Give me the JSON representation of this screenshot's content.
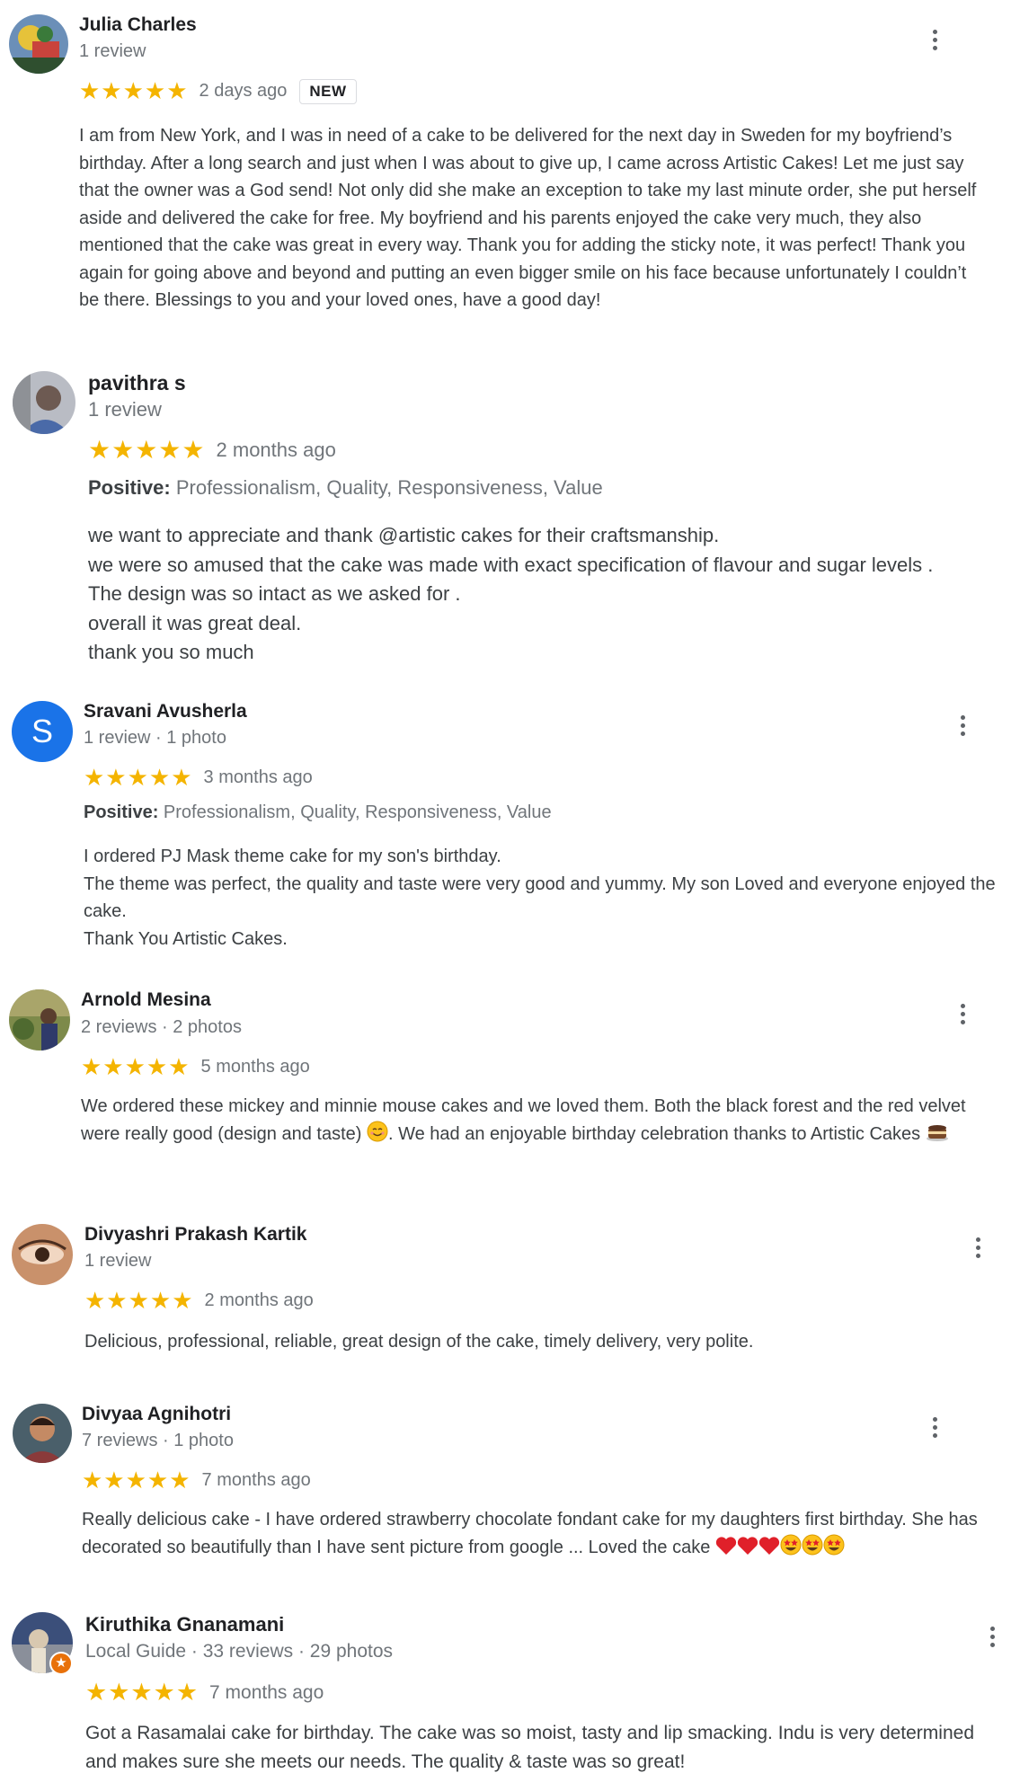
{
  "reviews": [
    {
      "name": "Julia Charles",
      "meta": "1 review",
      "stars": "★★★★★",
      "time": "2 days ago",
      "badge": "NEW",
      "text": "I am from New York, and I was in need of a cake to be delivered for the next day in Sweden for my boyfriend’s birthday. After a long search and just when I was about to give up, I came across Artistic Cakes! Let me just say that the owner was a God send! Not only did she make an exception to take my last minute order, she put herself aside and delivered the cake for free. My boyfriend and his parents enjoyed the cake very much, they also mentioned that the cake was great in every way. Thank you for adding the sticky note, it was perfect! Thank you again for going above and beyond and putting an even bigger smile on his face because unfortunately I couldn’t be there. Blessings to you and your loved ones, have a good day!"
    },
    {
      "name": "pavithra s",
      "meta": "1 review",
      "stars": "★★★★★",
      "time": "2 months ago",
      "positive_label": "Positive:",
      "positive_values": "Professionalism, Quality, Responsiveness, Value",
      "lines": [
        "we want to appreciate and thank @artistic cakes for their craftsmanship.",
        "we were so amused that the cake was made with exact specification of flavour and sugar levels .",
        "The design was so intact as we asked for .",
        "overall it was great deal.",
        "thank you so much"
      ]
    },
    {
      "name": "Sravani Avusherla",
      "avatar_letter": "S",
      "meta": "1 review · 1 photo",
      "stars": "★★★★★",
      "time": "3 months ago",
      "positive_label": "Positive:",
      "positive_values": "Professionalism, Quality, Responsiveness, Value",
      "lines": [
        "I ordered PJ Mask theme cake for my son's birthday.",
        "The theme was perfect, the quality and taste were very good and yummy. My son Loved and everyone enjoyed the cake.",
        "Thank You Artistic Cakes."
      ]
    },
    {
      "name": "Arnold Mesina",
      "meta": "2 reviews · 2 photos",
      "stars": "★★★★★",
      "time": "5 months ago",
      "text_a": "We ordered these mickey and minnie mouse cakes and we loved them. Both the black forest and the red velvet were really good (design and taste) ",
      "text_b": ". We had an enjoyable birthday celebration thanks to Artistic Cakes "
    },
    {
      "name": "Divyashri Prakash Kartik",
      "meta": "1 review",
      "stars": "★★★★★",
      "time": "2 months ago",
      "text": "Delicious, professional, reliable, great design of the cake, timely delivery, very polite."
    },
    {
      "name": "Divyaa Agnihotri",
      "meta": "7 reviews · 1 photo",
      "stars": "★★★★★",
      "time": "7 months ago",
      "text": "Really delicious cake - I have ordered strawberry chocolate fondant cake for my daughters first birthday. She has decorated so beautifully than I have sent picture from google ... Loved the cake "
    },
    {
      "name": "Kiruthika Gnanamani",
      "meta": "Local Guide · 33 reviews · 29 photos",
      "stars": "★★★★★",
      "time": "7 months ago",
      "text": "Got a Rasamalai cake for birthday. The cake was so moist, tasty and lip smacking. Indu is very determined and makes sure she meets our needs. The quality & taste was so great!"
    }
  ],
  "colors": {
    "star": "#f4b400",
    "sravani_avatar": "#1a73e8",
    "local_guide_badge": "#e8710a"
  }
}
